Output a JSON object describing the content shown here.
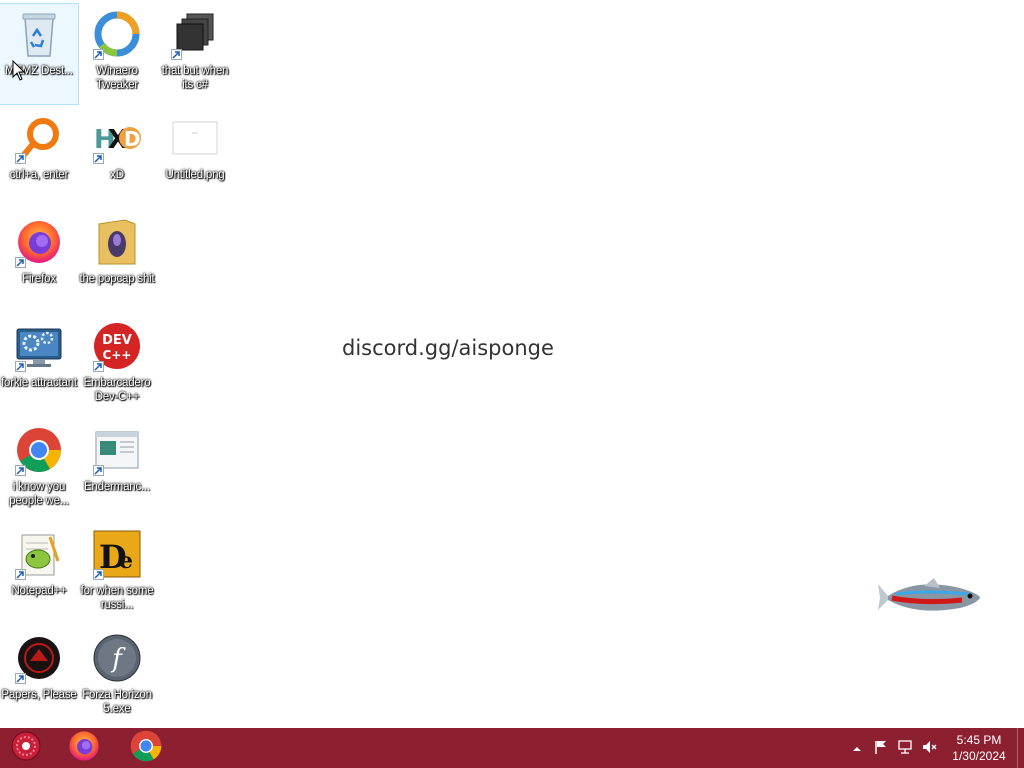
{
  "desktop": {
    "icons": [
      {
        "name": "recycle-bin-icon",
        "label": "MEMZ Dest...",
        "selected": true
      },
      {
        "name": "winaero-tweaker-icon",
        "label": "Winaero Tweaker"
      },
      {
        "name": "stack-icon",
        "label": "that but when its c#"
      },
      {
        "name": "magnifier-icon",
        "label": "ctrl+a, enter"
      },
      {
        "name": "hxd-icon",
        "label": "xD"
      },
      {
        "name": "image-file-icon",
        "label": "Untitled.png"
      },
      {
        "name": "firefox-icon",
        "label": "Firefox"
      },
      {
        "name": "folder-icon",
        "label": "the popcap shit"
      },
      {
        "name": "computer-gear-icon",
        "label": "forkie attractant"
      },
      {
        "name": "devcpp-icon",
        "label": "Embarcadero Dev-C++"
      },
      {
        "name": "chrome-icon",
        "label": "i know you people we..."
      },
      {
        "name": "window-icon",
        "label": "Endermanc..."
      },
      {
        "name": "notepadpp-icon",
        "label": "Notepad++"
      },
      {
        "name": "de-icon",
        "label": "for when some russi..."
      },
      {
        "name": "papers-please-icon",
        "label": "Papers, Please"
      },
      {
        "name": "flash-icon",
        "label": "Forza Horizon 5.exe"
      }
    ],
    "center_text": "discord.gg/aisponge"
  },
  "taskbar": {
    "color": "#8c2030",
    "pinned": [
      {
        "name": "start-orb-icon"
      },
      {
        "name": "firefox-icon"
      },
      {
        "name": "chrome-icon"
      }
    ],
    "tray": {
      "time": "5:45 PM",
      "date": "1/30/2024"
    }
  }
}
